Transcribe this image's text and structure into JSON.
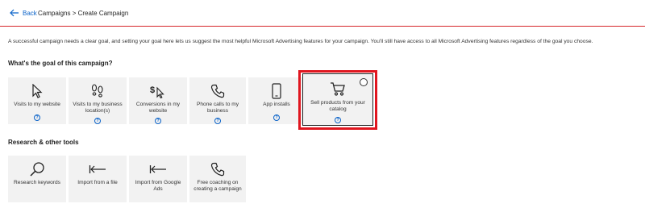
{
  "header": {
    "back_label": "Back",
    "breadcrumb": "Campaigns > Create Campaign"
  },
  "description": "A successful campaign needs a clear goal, and setting your goal here lets us suggest the most helpful Microsoft Advertising features for your campaign. You'll still have access to all Microsoft Advertising features regardless of the goal you choose.",
  "goals": {
    "title": "What's the goal of this campaign?",
    "items": [
      {
        "label": "Visits to my website",
        "icon": "cursor-icon",
        "help": "?"
      },
      {
        "label": "Visits to my business location(s)",
        "icon": "footprints-icon",
        "help": "?"
      },
      {
        "label": "Conversions in my website",
        "icon": "dollar-cursor-icon",
        "help": "?"
      },
      {
        "label": "Phone calls to my business",
        "icon": "phone-icon",
        "help": "?"
      },
      {
        "label": "App installs",
        "icon": "mobile-icon",
        "help": "?"
      },
      {
        "label": "Sell products from your catalog",
        "icon": "cart-icon",
        "help": "?",
        "selected": true
      }
    ]
  },
  "tools": {
    "title": "Research & other tools",
    "items": [
      {
        "label": "Research keywords",
        "icon": "search-icon"
      },
      {
        "label": "Import from a file",
        "icon": "import-icon"
      },
      {
        "label": "Import from Google Ads",
        "icon": "import-icon"
      },
      {
        "label": "Free coaching on creating a campaign",
        "icon": "phone-icon"
      }
    ]
  },
  "colors": {
    "accent": "#0b63c9",
    "highlight": "#e0161f",
    "tile_bg": "#f2f2f2"
  }
}
